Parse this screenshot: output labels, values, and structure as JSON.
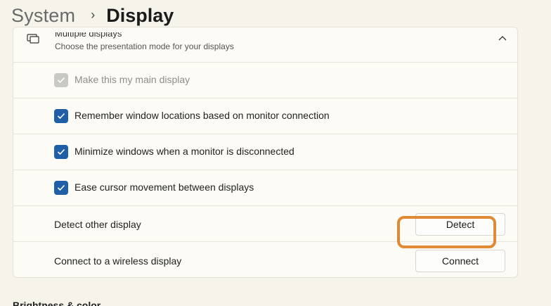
{
  "breadcrumb": {
    "parent": "System",
    "separator": "›",
    "current": "Display"
  },
  "multiple_displays": {
    "title": "Multiple displays",
    "subtitle": "Choose the presentation mode for your displays",
    "icon": "monitor-icon",
    "expanded": true
  },
  "options": [
    {
      "label": "Make this my main display",
      "checked": true,
      "disabled": true
    },
    {
      "label": "Remember window locations based on monitor connection",
      "checked": true,
      "disabled": false
    },
    {
      "label": "Minimize windows when a monitor is disconnected",
      "checked": true,
      "disabled": false
    },
    {
      "label": "Ease cursor movement between displays",
      "checked": true,
      "disabled": false
    }
  ],
  "detect": {
    "label": "Detect other display",
    "button": "Detect"
  },
  "connect": {
    "label": "Connect to a wireless display",
    "button": "Connect"
  },
  "next_section": {
    "title": "Brightness & color"
  },
  "colors": {
    "accent": "#1f5fa8",
    "highlight": "#e08a35",
    "background": "#f6f3ea"
  }
}
